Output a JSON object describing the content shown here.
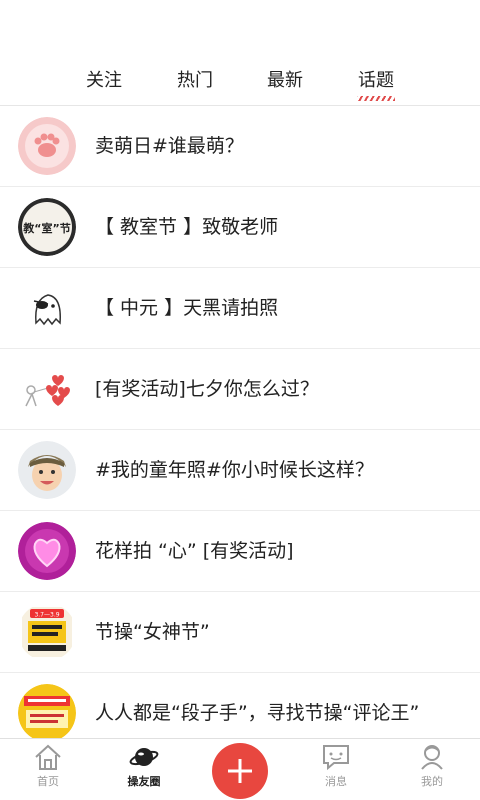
{
  "tabs": [
    {
      "label": "关注",
      "active": false
    },
    {
      "label": "热门",
      "active": false
    },
    {
      "label": "最新",
      "active": false
    },
    {
      "label": "话题",
      "active": true
    }
  ],
  "colors": {
    "accent": "#e8473f",
    "underline": "#e04b4b",
    "divider": "#ececec",
    "inactive_nav": "#999999"
  },
  "topics": [
    {
      "title": "卖萌日#谁最萌？",
      "icon": "cat-paw-icon"
    },
    {
      "title": "【 教室节 】致敬老师",
      "icon": "classroom-festival-badge-icon",
      "badge_text": "教“室”节"
    },
    {
      "title": "【 中元 】天黑请拍照",
      "icon": "ghost-icon"
    },
    {
      "title": "[有奖活动]七夕你怎么过？",
      "icon": "hearts-balloon-icon"
    },
    {
      "title": "#我的童年照#你小时候长这样？",
      "icon": "child-photo-icon"
    },
    {
      "title": "花样拍 “心” [有奖活动]",
      "icon": "neon-heart-icon"
    },
    {
      "title": "节操“女神节”",
      "icon": "goddess-festival-poster-icon",
      "badge_text": "3.7—3.9"
    },
    {
      "title": "人人都是“段子手”，寻找节操“评论王”",
      "icon": "comment-king-poster-icon"
    }
  ],
  "bottom_nav": {
    "home": {
      "label": "首页",
      "icon": "home-icon"
    },
    "circle": {
      "label": "操友圈",
      "icon": "planet-icon"
    },
    "add": {
      "icon": "plus-icon"
    },
    "messages": {
      "label": "消息",
      "icon": "message-icon"
    },
    "mine": {
      "label": "我的",
      "icon": "profile-icon"
    }
  }
}
